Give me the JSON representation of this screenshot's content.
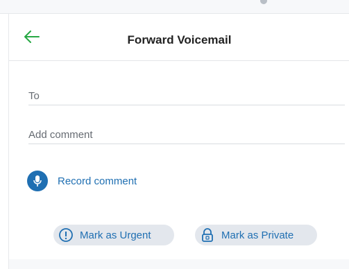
{
  "header": {
    "title": "Forward Voicemail",
    "back_icon": "arrow-left-icon"
  },
  "form": {
    "to_placeholder": "To",
    "comment_placeholder": "Add comment"
  },
  "record": {
    "label": "Record comment",
    "icon": "microphone-icon"
  },
  "actions": {
    "urgent_label": "Mark as Urgent",
    "urgent_icon": "alert-circle-icon",
    "private_label": "Mark as Private",
    "private_icon": "lock-icon"
  },
  "colors": {
    "accent_green": "#27a844",
    "accent_blue": "#1f6fb2",
    "pill_bg": "#e3e7ed"
  }
}
